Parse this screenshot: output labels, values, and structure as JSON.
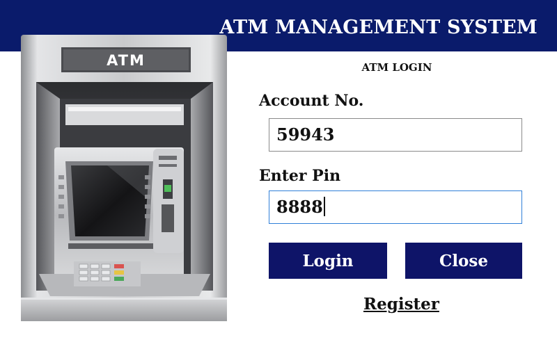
{
  "header": {
    "title": "ATM MANAGEMENT SYSTEM"
  },
  "illustration": {
    "atm_sign": "ATM"
  },
  "login": {
    "heading": "ATM LOGIN",
    "account_label": "Account No.",
    "account_value": "59943",
    "pin_label": "Enter Pin",
    "pin_value": "8888",
    "login_button": "Login",
    "close_button": "Close",
    "register_link": "Register"
  },
  "colors": {
    "header_bg": "#0a1b6b",
    "button_bg": "#0e1468",
    "focus_border": "#2f7fd8"
  }
}
